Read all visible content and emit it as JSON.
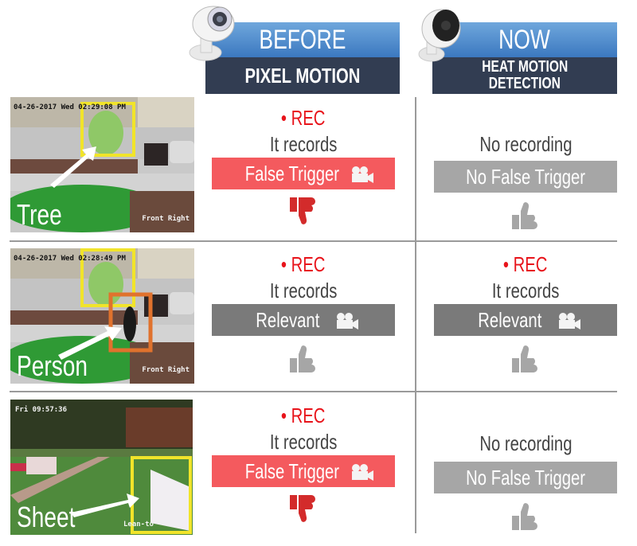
{
  "header": {
    "before": {
      "title": "BEFORE",
      "subtitle": "PIXEL MOTION",
      "camera_icon": "bullet-camera-icon"
    },
    "now": {
      "title": "NOW",
      "subtitle_line1": "HEAT MOTION",
      "subtitle_line2": "DETECTION",
      "camera_icon": "heat-camera-icon"
    }
  },
  "colors": {
    "rec_red": "#e8141b",
    "false_trigger_red": "#f45a5e",
    "relevant_grey": "#7a7a7a",
    "no_false_grey": "#a6a6a6",
    "thumb_down_red": "#d32b2b",
    "thumb_up_grey": "#a6a6a6",
    "header_blue": "#4a87cc",
    "header_dark": "#323d52"
  },
  "rows": [
    {
      "photo": {
        "label": "Tree",
        "timestamp": "04-26-2017 Wed 02:29:08 PM",
        "corner_text": "Front Right"
      },
      "before": {
        "rec": "• REC",
        "status": "It records",
        "badge": "False Trigger",
        "badge_icon": "video-camera-icon",
        "verdict_icon": "thumbs-down-icon"
      },
      "now": {
        "rec": "",
        "status": "No recording",
        "badge": "No False Trigger",
        "badge_icon": "",
        "verdict_icon": "thumbs-up-icon"
      }
    },
    {
      "photo": {
        "label": "Person",
        "timestamp": "04-26-2017 Wed 02:28:49 PM",
        "corner_text": "Front Right"
      },
      "before": {
        "rec": "• REC",
        "status": "It records",
        "badge": "Relevant",
        "badge_icon": "video-camera-icon",
        "verdict_icon": "thumbs-up-icon"
      },
      "now": {
        "rec": "• REC",
        "status": "It records",
        "badge": "Relevant",
        "badge_icon": "video-camera-icon",
        "verdict_icon": "thumbs-up-icon"
      }
    },
    {
      "photo": {
        "label": "Sheet",
        "timestamp": "Fri 09:57:36",
        "corner_text": "Lean-to"
      },
      "before": {
        "rec": "• REC",
        "status": "It records",
        "badge": "False Trigger",
        "badge_icon": "video-camera-icon",
        "verdict_icon": "thumbs-down-icon"
      },
      "now": {
        "rec": "",
        "status": "No recording",
        "badge": "No False Trigger",
        "badge_icon": "",
        "verdict_icon": "thumbs-up-icon"
      }
    }
  ]
}
